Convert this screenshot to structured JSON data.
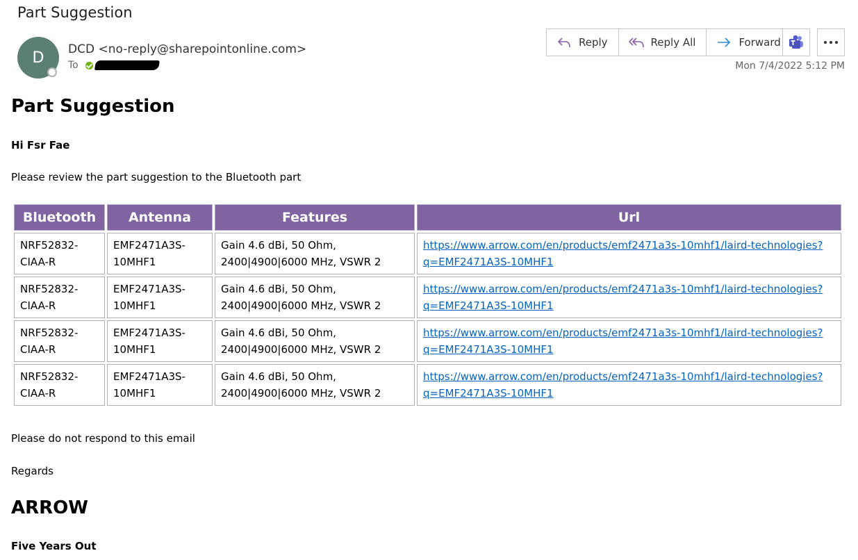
{
  "header": {
    "subject": "Part Suggestion",
    "avatar_initial": "D",
    "sender": "DCD <no-reply@sharepointonline.com>",
    "to_label": "To",
    "date": "Mon 7/4/2022 5:12 PM"
  },
  "actions": {
    "reply": "Reply",
    "reply_all": "Reply All",
    "forward": "Forward"
  },
  "body": {
    "heading": "Part Suggestion",
    "greeting": "Hi Fsr Fae",
    "intro": "Please review the part suggestion to the Bluetooth part",
    "table": {
      "headers": [
        "Bluetooth",
        "Antenna",
        "Features",
        "Url"
      ],
      "rows": [
        {
          "bluetooth_1": "NRF52832-",
          "bluetooth_2": "CIAA-R",
          "antenna_1": "EMF2471A3S-",
          "antenna_2": "10MHF1",
          "features_1": "Gain 4.6 dBi, 50 Ohm,",
          "features_2": "2400|4900|6000 MHz, VSWR 2",
          "url_1": "https://www.arrow.com/en/products/emf2471a3s-10mhf1/laird-technologies?",
          "url_2": "q=EMF2471A3S-10MHF1"
        },
        {
          "bluetooth_1": "NRF52832-",
          "bluetooth_2": "CIAA-R",
          "antenna_1": "EMF2471A3S-",
          "antenna_2": "10MHF1",
          "features_1": "Gain 4.6 dBi, 50 Ohm,",
          "features_2": "2400|4900|6000 MHz, VSWR 2",
          "url_1": "https://www.arrow.com/en/products/emf2471a3s-10mhf1/laird-technologies?",
          "url_2": "q=EMF2471A3S-10MHF1"
        },
        {
          "bluetooth_1": "NRF52832-",
          "bluetooth_2": "CIAA-R",
          "antenna_1": "EMF2471A3S-",
          "antenna_2": "10MHF1",
          "features_1": "Gain 4.6 dBi, 50 Ohm,",
          "features_2": "2400|4900|6000 MHz, VSWR 2",
          "url_1": "https://www.arrow.com/en/products/emf2471a3s-10mhf1/laird-technologies?",
          "url_2": "q=EMF2471A3S-10MHF1"
        },
        {
          "bluetooth_1": "NRF52832-",
          "bluetooth_2": "CIAA-R",
          "antenna_1": "EMF2471A3S-",
          "antenna_2": "10MHF1",
          "features_1": "Gain 4.6 dBi, 50 Ohm,",
          "features_2": "2400|4900|6000 MHz, VSWR 2",
          "url_1": "https://www.arrow.com/en/products/emf2471a3s-10mhf1/laird-technologies?",
          "url_2": "q=EMF2471A3S-10MHF1"
        }
      ]
    },
    "closing": "Please do not respond to this email",
    "regards": "Regards",
    "brand": "ARROW",
    "tagline": "Five Years Out"
  },
  "colors": {
    "header_purple": "#8064a2",
    "avatar": "#5b7f74",
    "link": "#0563c1",
    "presence_green": "#6bb700",
    "teams_purple": "#5059c9"
  },
  "icons": [
    "reply-icon",
    "reply-all-icon",
    "forward-icon",
    "teams-icon",
    "more-icon",
    "presence-available-icon"
  ]
}
